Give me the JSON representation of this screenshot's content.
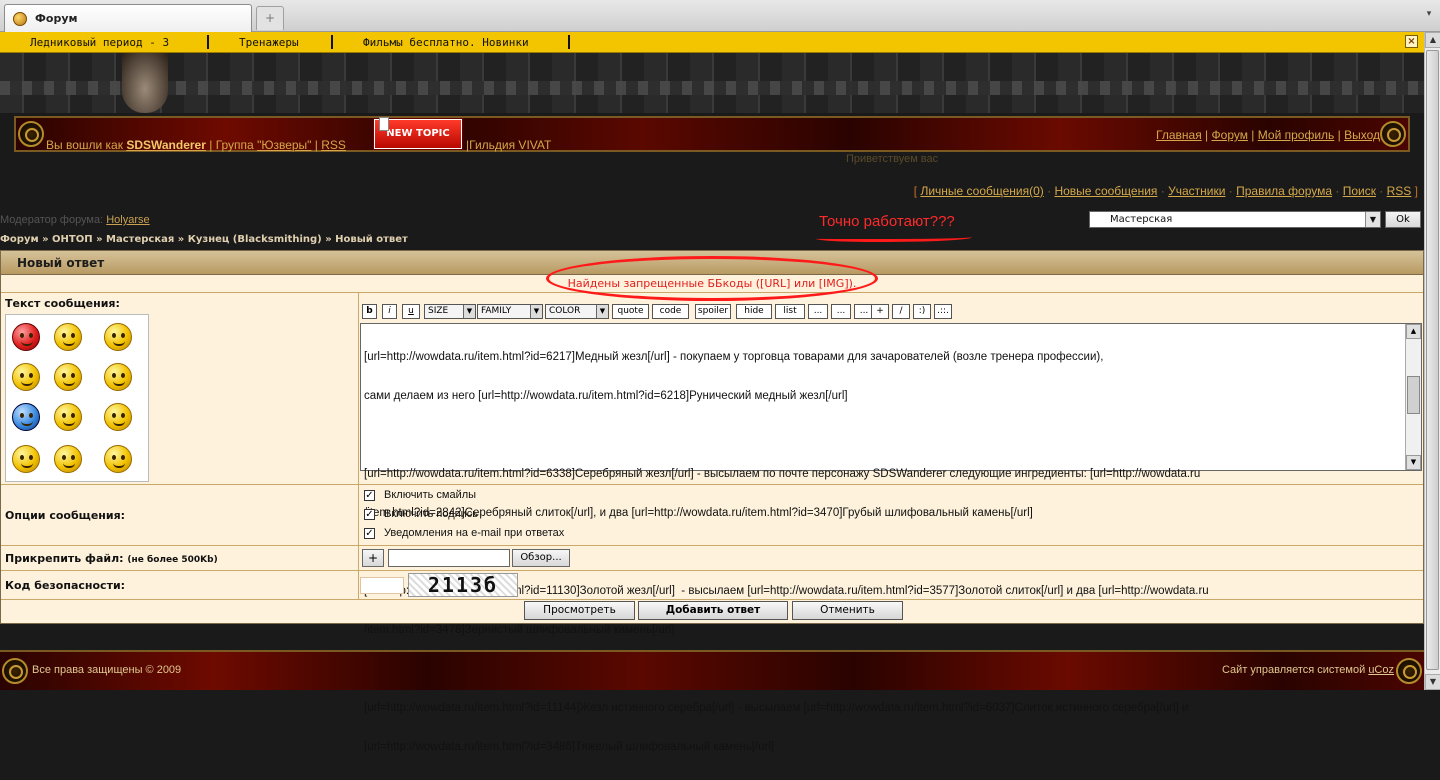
{
  "browser": {
    "tab_title": "Форум",
    "tab_close": "×",
    "new_tab": "+",
    "tabs_menu": "▾"
  },
  "topbar": {
    "links": [
      "Ледниковый период - 3",
      "Тренажеры",
      "Фильмы бесплатно. Новинки"
    ],
    "close": "×"
  },
  "userbar": {
    "prefix": "Вы вошли как ",
    "username": "SDSWanderer",
    "group_prefix": " | Группа ",
    "group": "\"Юзверы\"",
    "rss_sep": " | ",
    "rss": "RSS",
    "new_topic": "NEW TOPIC",
    "guild": "|Гильдия VIVAT",
    "right_links": [
      "Главная",
      "Форум",
      "Мой профиль",
      "Выход"
    ],
    "right_sep": " | ",
    "greeting": "Приветствуем вас"
  },
  "toplinks": {
    "open_bracket": "[ ",
    "items": [
      "Личные сообщения(0)",
      "Новые сообщения",
      "Участники",
      "Правила форума",
      "Поиск",
      "RSS"
    ],
    "sep": " · ",
    "close_bracket": " ]"
  },
  "moderator": {
    "label": "Модератор форума: ",
    "name": "Holyarse"
  },
  "breadcrumb": "Форум » ОНТОП » Мастерская » Кузнец (Blacksmithing) » Новый ответ",
  "annotation": "Точно работают???",
  "forum_select": {
    "value": "Мастерская",
    "ok": "Ok"
  },
  "panel": {
    "title": "Новый ответ",
    "error": "Найдены запрещенные ББкоды ([URL] или [IMG]).",
    "message_label": "Текст сообщения:",
    "options_label": "Опции сообщения:",
    "attach_label": "Прикрепить файл: ",
    "attach_limit": "(не более 500Kb)",
    "security_label": "Код безопасности:",
    "bbcodes": [
      "b",
      "i",
      "u",
      "SIZE",
      "FAMILY",
      "COLOR",
      "quote",
      "code",
      "spoiler",
      "hide",
      "list",
      "...",
      "...",
      "...",
      "+",
      "/",
      ":)",
      ".::."
    ],
    "message_lines": [
      "[url=http://wowdata.ru/item.html?id=6217]Медный жезл[/url] - покупаем у торговца товарами для зачарователей (возле тренера профессии),",
      "сами делаем из него [url=http://wowdata.ru/item.html?id=6218]Рунический медный жезл[/url]",
      "",
      "[url=http://wowdata.ru/item.html?id=6338]Серебряный жезл[/url] - высылаем по почте персонажу SDSWanderer следующие ингредиенты: [url=http://wowdata.ru",
      "/item.html?id=2842]Серебряный слиток[/url], и два [url=http://wowdata.ru/item.html?id=3470]Грубый шлифовальный камень[/url]",
      "",
      "[url=http://wowdata.ru/item.html?id=11130]Золотой жезл[/url]  - высылаем [url=http://wowdata.ru/item.html?id=3577]Золотой слиток[/url] и два [url=http://wowdata.ru",
      "/item.html?id=3478]Зернистый шлифовальный камень[/url]",
      "",
      "[url=http://wowdata.ru/item.html?id=11144]Жезл истинного серебра[/url] - высылаем [url=http://wowdata.ru/item.html?id=6037]Слиток истинного серебра[/url] и",
      "[url=http://wowdata.ru/item.html?id=3486]Тяжелый шлифовальный камень[/url]"
    ],
    "options": [
      "Включить смайлы",
      "Включить подпись",
      "Уведомления на e-mail при ответах"
    ],
    "option_checked": "✓",
    "attach_plus": "+",
    "browse": "Обзор...",
    "captcha": "2113б",
    "buttons": {
      "preview": "Просмотреть",
      "submit": "Добавить ответ",
      "cancel": "Отменить"
    }
  },
  "footer": {
    "copyright": "Все права защищены © 2009",
    "powered_prefix": "Сайт управляется системой ",
    "powered_link": "uCoz"
  }
}
